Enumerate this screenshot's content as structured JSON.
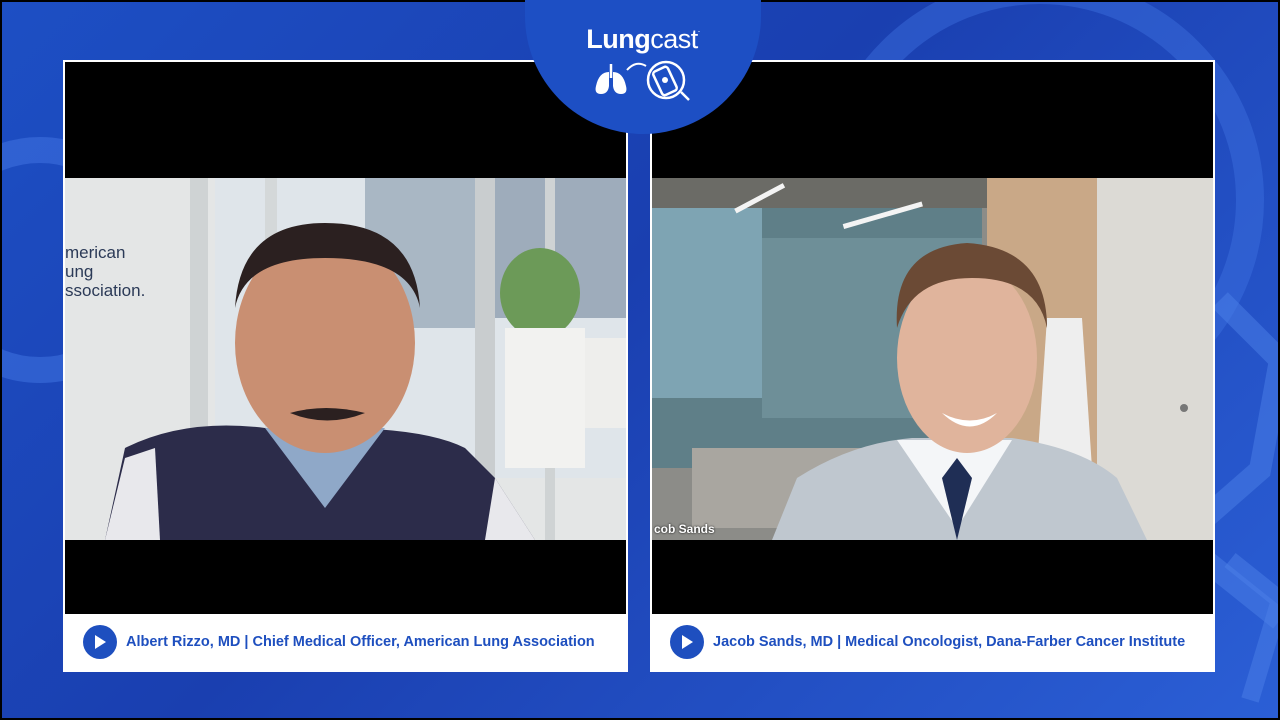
{
  "brand": {
    "name_bold": "Lung",
    "name_light": "cast",
    "trademark": ".",
    "logo_icon": "lungs-and-phone-icon"
  },
  "colors": {
    "background": "#1d4fc4",
    "caption_text": "#1e4fbf",
    "caption_bg": "#ffffff"
  },
  "participants": [
    {
      "caption": "Albert Rizzo, MD | Chief Medical Officer, American Lung Association",
      "play_icon": "play-icon",
      "background_sign": [
        "merican",
        "ung",
        "ssociation."
      ]
    },
    {
      "caption": "Jacob Sands, MD | Medical Oncologist, Dana-Farber Cancer Institute",
      "play_icon": "play-icon",
      "video_name_tag": "cob Sands"
    }
  ]
}
